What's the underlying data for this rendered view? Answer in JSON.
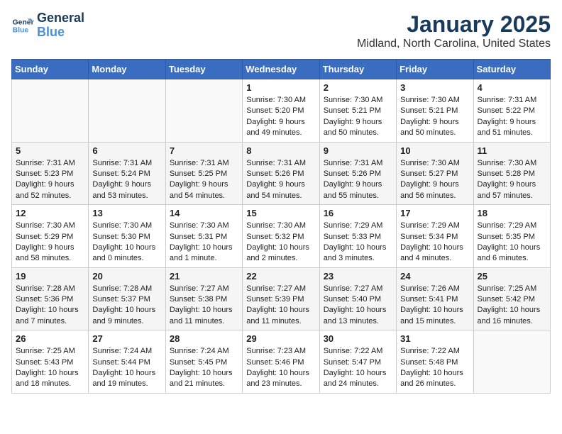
{
  "header": {
    "logo_line1": "General",
    "logo_line2": "Blue",
    "month": "January 2025",
    "location": "Midland, North Carolina, United States"
  },
  "days_of_week": [
    "Sunday",
    "Monday",
    "Tuesday",
    "Wednesday",
    "Thursday",
    "Friday",
    "Saturday"
  ],
  "weeks": [
    [
      {
        "day": "",
        "info": ""
      },
      {
        "day": "",
        "info": ""
      },
      {
        "day": "",
        "info": ""
      },
      {
        "day": "1",
        "info": "Sunrise: 7:30 AM\nSunset: 5:20 PM\nDaylight: 9 hours\nand 49 minutes."
      },
      {
        "day": "2",
        "info": "Sunrise: 7:30 AM\nSunset: 5:21 PM\nDaylight: 9 hours\nand 50 minutes."
      },
      {
        "day": "3",
        "info": "Sunrise: 7:30 AM\nSunset: 5:21 PM\nDaylight: 9 hours\nand 50 minutes."
      },
      {
        "day": "4",
        "info": "Sunrise: 7:31 AM\nSunset: 5:22 PM\nDaylight: 9 hours\nand 51 minutes."
      }
    ],
    [
      {
        "day": "5",
        "info": "Sunrise: 7:31 AM\nSunset: 5:23 PM\nDaylight: 9 hours\nand 52 minutes."
      },
      {
        "day": "6",
        "info": "Sunrise: 7:31 AM\nSunset: 5:24 PM\nDaylight: 9 hours\nand 53 minutes."
      },
      {
        "day": "7",
        "info": "Sunrise: 7:31 AM\nSunset: 5:25 PM\nDaylight: 9 hours\nand 54 minutes."
      },
      {
        "day": "8",
        "info": "Sunrise: 7:31 AM\nSunset: 5:26 PM\nDaylight: 9 hours\nand 54 minutes."
      },
      {
        "day": "9",
        "info": "Sunrise: 7:31 AM\nSunset: 5:26 PM\nDaylight: 9 hours\nand 55 minutes."
      },
      {
        "day": "10",
        "info": "Sunrise: 7:30 AM\nSunset: 5:27 PM\nDaylight: 9 hours\nand 56 minutes."
      },
      {
        "day": "11",
        "info": "Sunrise: 7:30 AM\nSunset: 5:28 PM\nDaylight: 9 hours\nand 57 minutes."
      }
    ],
    [
      {
        "day": "12",
        "info": "Sunrise: 7:30 AM\nSunset: 5:29 PM\nDaylight: 9 hours\nand 58 minutes."
      },
      {
        "day": "13",
        "info": "Sunrise: 7:30 AM\nSunset: 5:30 PM\nDaylight: 10 hours\nand 0 minutes."
      },
      {
        "day": "14",
        "info": "Sunrise: 7:30 AM\nSunset: 5:31 PM\nDaylight: 10 hours\nand 1 minute."
      },
      {
        "day": "15",
        "info": "Sunrise: 7:30 AM\nSunset: 5:32 PM\nDaylight: 10 hours\nand 2 minutes."
      },
      {
        "day": "16",
        "info": "Sunrise: 7:29 AM\nSunset: 5:33 PM\nDaylight: 10 hours\nand 3 minutes."
      },
      {
        "day": "17",
        "info": "Sunrise: 7:29 AM\nSunset: 5:34 PM\nDaylight: 10 hours\nand 4 minutes."
      },
      {
        "day": "18",
        "info": "Sunrise: 7:29 AM\nSunset: 5:35 PM\nDaylight: 10 hours\nand 6 minutes."
      }
    ],
    [
      {
        "day": "19",
        "info": "Sunrise: 7:28 AM\nSunset: 5:36 PM\nDaylight: 10 hours\nand 7 minutes."
      },
      {
        "day": "20",
        "info": "Sunrise: 7:28 AM\nSunset: 5:37 PM\nDaylight: 10 hours\nand 9 minutes."
      },
      {
        "day": "21",
        "info": "Sunrise: 7:27 AM\nSunset: 5:38 PM\nDaylight: 10 hours\nand 11 minutes."
      },
      {
        "day": "22",
        "info": "Sunrise: 7:27 AM\nSunset: 5:39 PM\nDaylight: 10 hours\nand 11 minutes."
      },
      {
        "day": "23",
        "info": "Sunrise: 7:27 AM\nSunset: 5:40 PM\nDaylight: 10 hours\nand 13 minutes."
      },
      {
        "day": "24",
        "info": "Sunrise: 7:26 AM\nSunset: 5:41 PM\nDaylight: 10 hours\nand 15 minutes."
      },
      {
        "day": "25",
        "info": "Sunrise: 7:25 AM\nSunset: 5:42 PM\nDaylight: 10 hours\nand 16 minutes."
      }
    ],
    [
      {
        "day": "26",
        "info": "Sunrise: 7:25 AM\nSunset: 5:43 PM\nDaylight: 10 hours\nand 18 minutes."
      },
      {
        "day": "27",
        "info": "Sunrise: 7:24 AM\nSunset: 5:44 PM\nDaylight: 10 hours\nand 19 minutes."
      },
      {
        "day": "28",
        "info": "Sunrise: 7:24 AM\nSunset: 5:45 PM\nDaylight: 10 hours\nand 21 minutes."
      },
      {
        "day": "29",
        "info": "Sunrise: 7:23 AM\nSunset: 5:46 PM\nDaylight: 10 hours\nand 23 minutes."
      },
      {
        "day": "30",
        "info": "Sunrise: 7:22 AM\nSunset: 5:47 PM\nDaylight: 10 hours\nand 24 minutes."
      },
      {
        "day": "31",
        "info": "Sunrise: 7:22 AM\nSunset: 5:48 PM\nDaylight: 10 hours\nand 26 minutes."
      },
      {
        "day": "",
        "info": ""
      }
    ]
  ]
}
